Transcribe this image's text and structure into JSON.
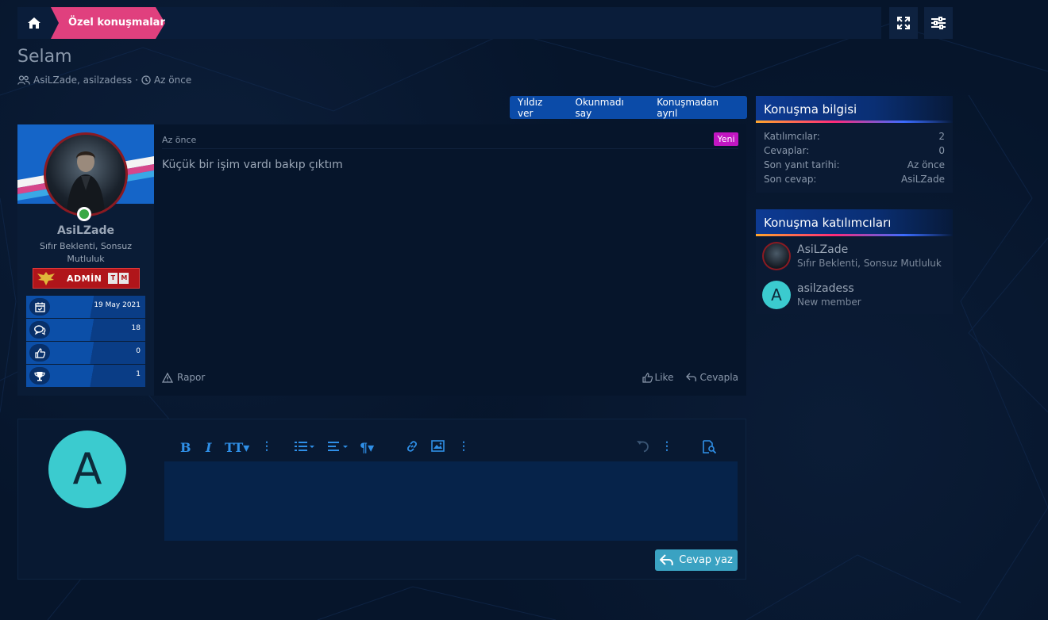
{
  "breadcrumb": {
    "current": "Özel konuşmalar"
  },
  "thread": {
    "title": "Selam",
    "participants_line": "AsiLZade, asilzadess",
    "separator": "·",
    "time": "Az önce"
  },
  "actions": [
    "Yıldız ver",
    "Okunmadı say",
    "Konuşmadan ayrıl"
  ],
  "post": {
    "username": "AsiLZade",
    "user_title": "Sıfır Beklenti, Sonsuz Mutluluk",
    "banner_text": "ADMİN",
    "banner_tm": [
      "T",
      "M"
    ],
    "stats": [
      {
        "icon": "calendar-check-icon",
        "value": "19 May 2021"
      },
      {
        "icon": "comments-icon",
        "value": "18"
      },
      {
        "icon": "thumbs-up-icon",
        "value": "0"
      },
      {
        "icon": "trophy-icon",
        "value": "1"
      }
    ],
    "date": "Az önce",
    "badge": "Yeni",
    "body": "Küçük bir işim vardı bakıp çıktım",
    "report": "Rapor",
    "like": "Like",
    "reply": "Cevapla"
  },
  "info": {
    "title": "Konuşma bilgisi",
    "rows": [
      {
        "k": "Katılımcılar:",
        "v": "2"
      },
      {
        "k": "Cevaplar:",
        "v": "0"
      },
      {
        "k": "Son yanıt tarihi:",
        "v": "Az önce"
      },
      {
        "k": "Son cevap:",
        "v": "AsiLZade"
      }
    ]
  },
  "participants": {
    "title": "Konuşma katılımcıları",
    "list": [
      {
        "name": "AsiLZade",
        "sub": "Sıfır Beklenti, Sonsuz Mutluluk"
      },
      {
        "name": "asilzadess",
        "sub": "New member",
        "letter": "A"
      }
    ]
  },
  "reply_box": {
    "avatar_letter": "A",
    "submit": "Cevap yaz"
  },
  "colors": {
    "background": "#06152b",
    "accent_pink": "#e0407e",
    "accent_blue": "#0b4ba8",
    "badge_new": "#c216c2",
    "submit": "#3aa2c2",
    "avatar_teal": "#3bcbcf"
  }
}
